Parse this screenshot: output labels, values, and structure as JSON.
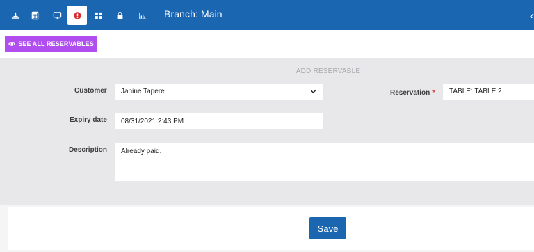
{
  "topbar": {
    "icons": [
      {
        "name": "dish-icon"
      },
      {
        "name": "calculator-icon"
      },
      {
        "name": "monitor-icon"
      },
      {
        "name": "alert-icon",
        "active": true
      },
      {
        "name": "grid-icon"
      },
      {
        "name": "lock-icon"
      },
      {
        "name": "chart-icon"
      }
    ],
    "branch_label": "Branch: Main"
  },
  "toolbar": {
    "see_all_label": "SEE ALL RESERVABLES"
  },
  "form": {
    "title": "ADD RESERVABLE",
    "customer": {
      "label": "Customer",
      "value": "Janine Tapere"
    },
    "reservation": {
      "label": "Reservation",
      "required_mark": "*",
      "value": "TABLE: TABLE 2"
    },
    "expiry": {
      "label": "Expiry date",
      "value": "08/31/2021 2:43 PM"
    },
    "description": {
      "label": "Description",
      "value": "Already paid."
    }
  },
  "footer": {
    "save_label": "Save"
  },
  "colors": {
    "primary": "#1b66b1",
    "accent": "#b04ef0",
    "alert": "#d62b2b",
    "panel": "#e8e8ea"
  }
}
